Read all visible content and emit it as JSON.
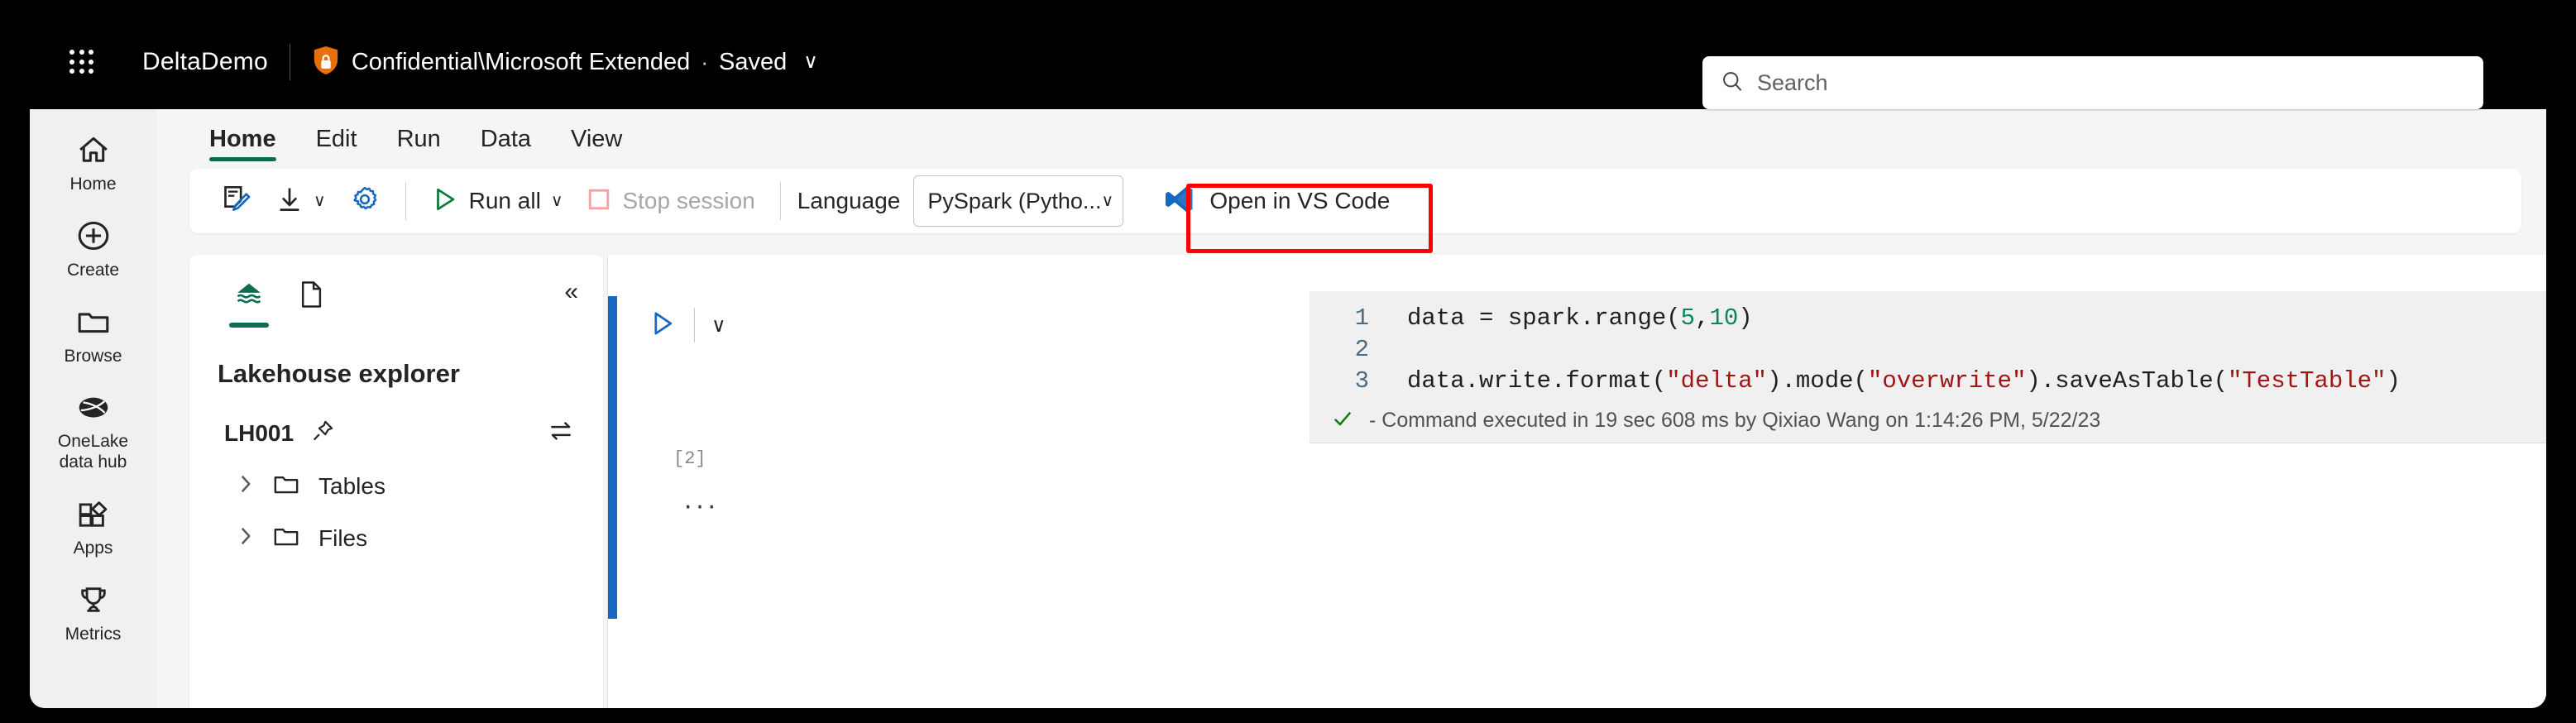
{
  "titlebar": {
    "waffle_icon": "app-launcher-icon",
    "app_title": "DeltaDemo",
    "shield_icon": "sensitivity-shield-lock-icon",
    "sensitivity_label": "Confidential\\Microsoft Extended",
    "dot": "·",
    "saved_label": "Saved",
    "chevron": "∨"
  },
  "search": {
    "icon": "search-icon",
    "placeholder": "Search",
    "value": ""
  },
  "rail": {
    "items": [
      {
        "label": "Home",
        "icon": "home-icon"
      },
      {
        "label": "Create",
        "icon": "plus-circle-icon"
      },
      {
        "label": "Browse",
        "icon": "folder-icon"
      },
      {
        "label": "OneLake\ndata hub",
        "label_line1": "OneLake",
        "label_line2": "data hub",
        "icon": "onelake-icon"
      },
      {
        "label": "Apps",
        "icon": "apps-grid-icon"
      },
      {
        "label": "Metrics",
        "icon": "trophy-icon"
      }
    ]
  },
  "ribbon": {
    "tabs": [
      {
        "label": "Home",
        "active": true
      },
      {
        "label": "Edit",
        "active": false
      },
      {
        "label": "Run",
        "active": false
      },
      {
        "label": "Data",
        "active": false
      },
      {
        "label": "View",
        "active": false
      }
    ]
  },
  "toolbar": {
    "edit_notebook_icon": "notebook-pencil-icon",
    "download_icon": "download-icon",
    "download_chevron": "∨",
    "settings_icon": "gear-icon",
    "run_all_icon": "play-triangle-icon",
    "run_all_label": "Run all",
    "run_all_chevron": "∨",
    "stop_session_icon": "stop-square-icon",
    "stop_session_label": "Stop session",
    "language_label": "Language",
    "language_value": "PySpark (Pytho...",
    "language_chevron": "∨",
    "vscode_icon": "vscode-logo-icon",
    "vscode_label": "Open in VS Code",
    "highlight_color": "#ff0000",
    "accent_green": "#0f6b52",
    "accent_blue": "#1668c1"
  },
  "explorer": {
    "tab_lakehouse_icon": "lakehouse-icon",
    "tab_file_icon": "file-icon",
    "collapse_icon": "chevron-double-left-icon",
    "title": "Lakehouse explorer",
    "lakehouse_name": "LH001",
    "pin_icon": "pin-icon",
    "swap_icon": "swap-arrows-icon",
    "tree": [
      {
        "label": "Tables",
        "expand_icon": "chevron-right-icon",
        "icon": "folder-icon"
      },
      {
        "label": "Files",
        "expand_icon": "chevron-right-icon",
        "icon": "folder-icon"
      }
    ]
  },
  "notebook": {
    "run_cell_icon": "play-triangle-outline-icon",
    "cell_chevron": "∨",
    "execution_count": "[2]",
    "more_options": "···",
    "code_lines": [
      {
        "number": "1",
        "tokens": [
          {
            "t": "data = spark.range(",
            "c": "plain"
          },
          {
            "t": "5",
            "c": "num"
          },
          {
            "t": ",",
            "c": "plain"
          },
          {
            "t": "10",
            "c": "num"
          },
          {
            "t": ")",
            "c": "plain"
          }
        ]
      },
      {
        "number": "2",
        "tokens": [
          {
            "t": "",
            "c": "plain"
          }
        ]
      },
      {
        "number": "3",
        "tokens": [
          {
            "t": "data.write.format(",
            "c": "plain"
          },
          {
            "t": "\"delta\"",
            "c": "str"
          },
          {
            "t": ").mode(",
            "c": "plain"
          },
          {
            "t": "\"overwrite\"",
            "c": "str"
          },
          {
            "t": ").saveAsTable(",
            "c": "plain"
          },
          {
            "t": "\"TestTable\"",
            "c": "str"
          },
          {
            "t": ")",
            "c": "plain"
          }
        ]
      }
    ],
    "status_icon": "checkmark-icon",
    "status_text": "- Command executed in 19 sec 608 ms by Qixiao Wang on 1:14:26 PM, 5/22/23"
  }
}
